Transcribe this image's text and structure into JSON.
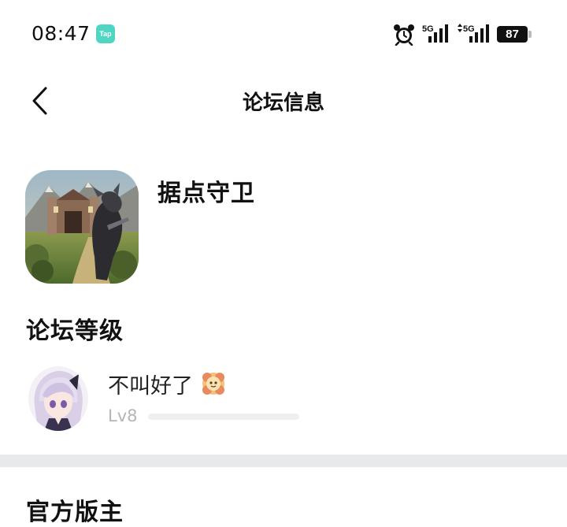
{
  "status_bar": {
    "time": "08:47",
    "app_badge": "Tap",
    "signal_1": "5G",
    "signal_2": "5G",
    "battery": "87"
  },
  "nav": {
    "title": "论坛信息"
  },
  "forum": {
    "name": "据点守卫"
  },
  "level_section": {
    "title": "论坛等级",
    "username": "不叫好了",
    "level": "Lv8",
    "level_progress": 0.0
  },
  "moderator_section": {
    "title": "官方版主"
  },
  "colors": {
    "divider": "#e8e9eb",
    "tap_badge": "#4fd6c3",
    "muted_text": "#b5b5b5"
  }
}
